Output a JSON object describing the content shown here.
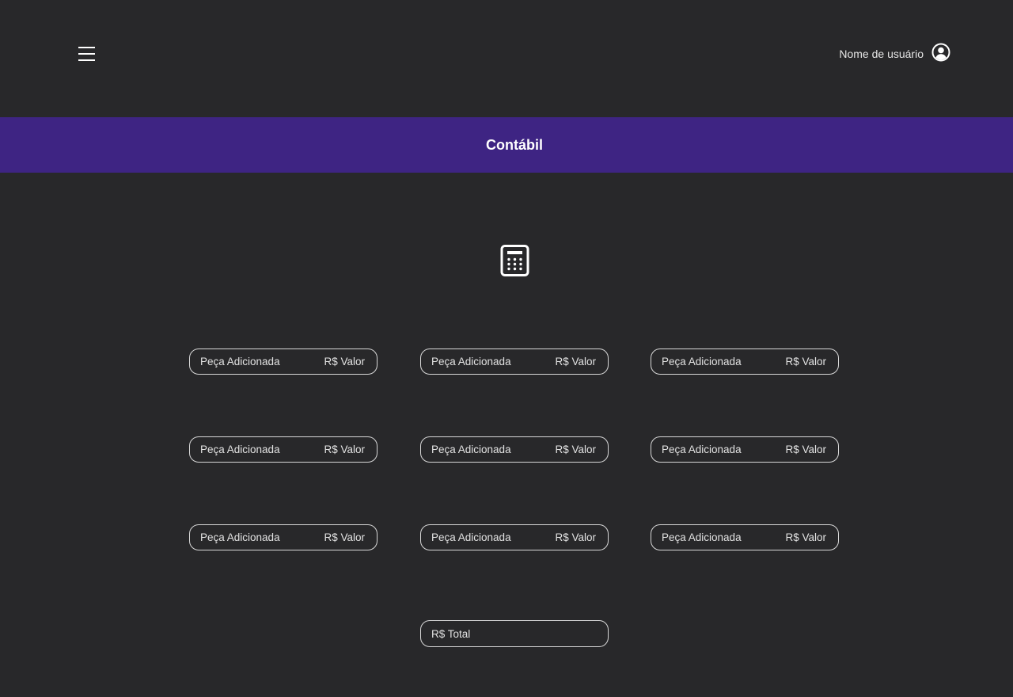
{
  "header": {
    "menu_icon": "hamburger-menu-icon",
    "user_name": "Nome de usuário",
    "user_icon": "user-avatar-icon"
  },
  "banner": {
    "title": "Contábil",
    "color": "#3e2483"
  },
  "main": {
    "icon": "calculator-icon",
    "parts": [
      {
        "name": "Peça Adicionada",
        "value": "R$ Valor"
      },
      {
        "name": "Peça Adicionada",
        "value": "R$ Valor"
      },
      {
        "name": "Peça Adicionada",
        "value": "R$ Valor"
      },
      {
        "name": "Peça Adicionada",
        "value": "R$ Valor"
      },
      {
        "name": "Peça Adicionada",
        "value": "R$ Valor"
      },
      {
        "name": "Peça Adicionada",
        "value": "R$ Valor"
      },
      {
        "name": "Peça Adicionada",
        "value": "R$ Valor"
      },
      {
        "name": "Peça Adicionada",
        "value": "R$ Valor"
      },
      {
        "name": "Peça Adicionada",
        "value": "R$ Valor"
      }
    ],
    "total_label": "R$ Total"
  },
  "colors": {
    "background": "#28282a",
    "border": "#d8d8d8",
    "text": "#e2e2e2"
  }
}
